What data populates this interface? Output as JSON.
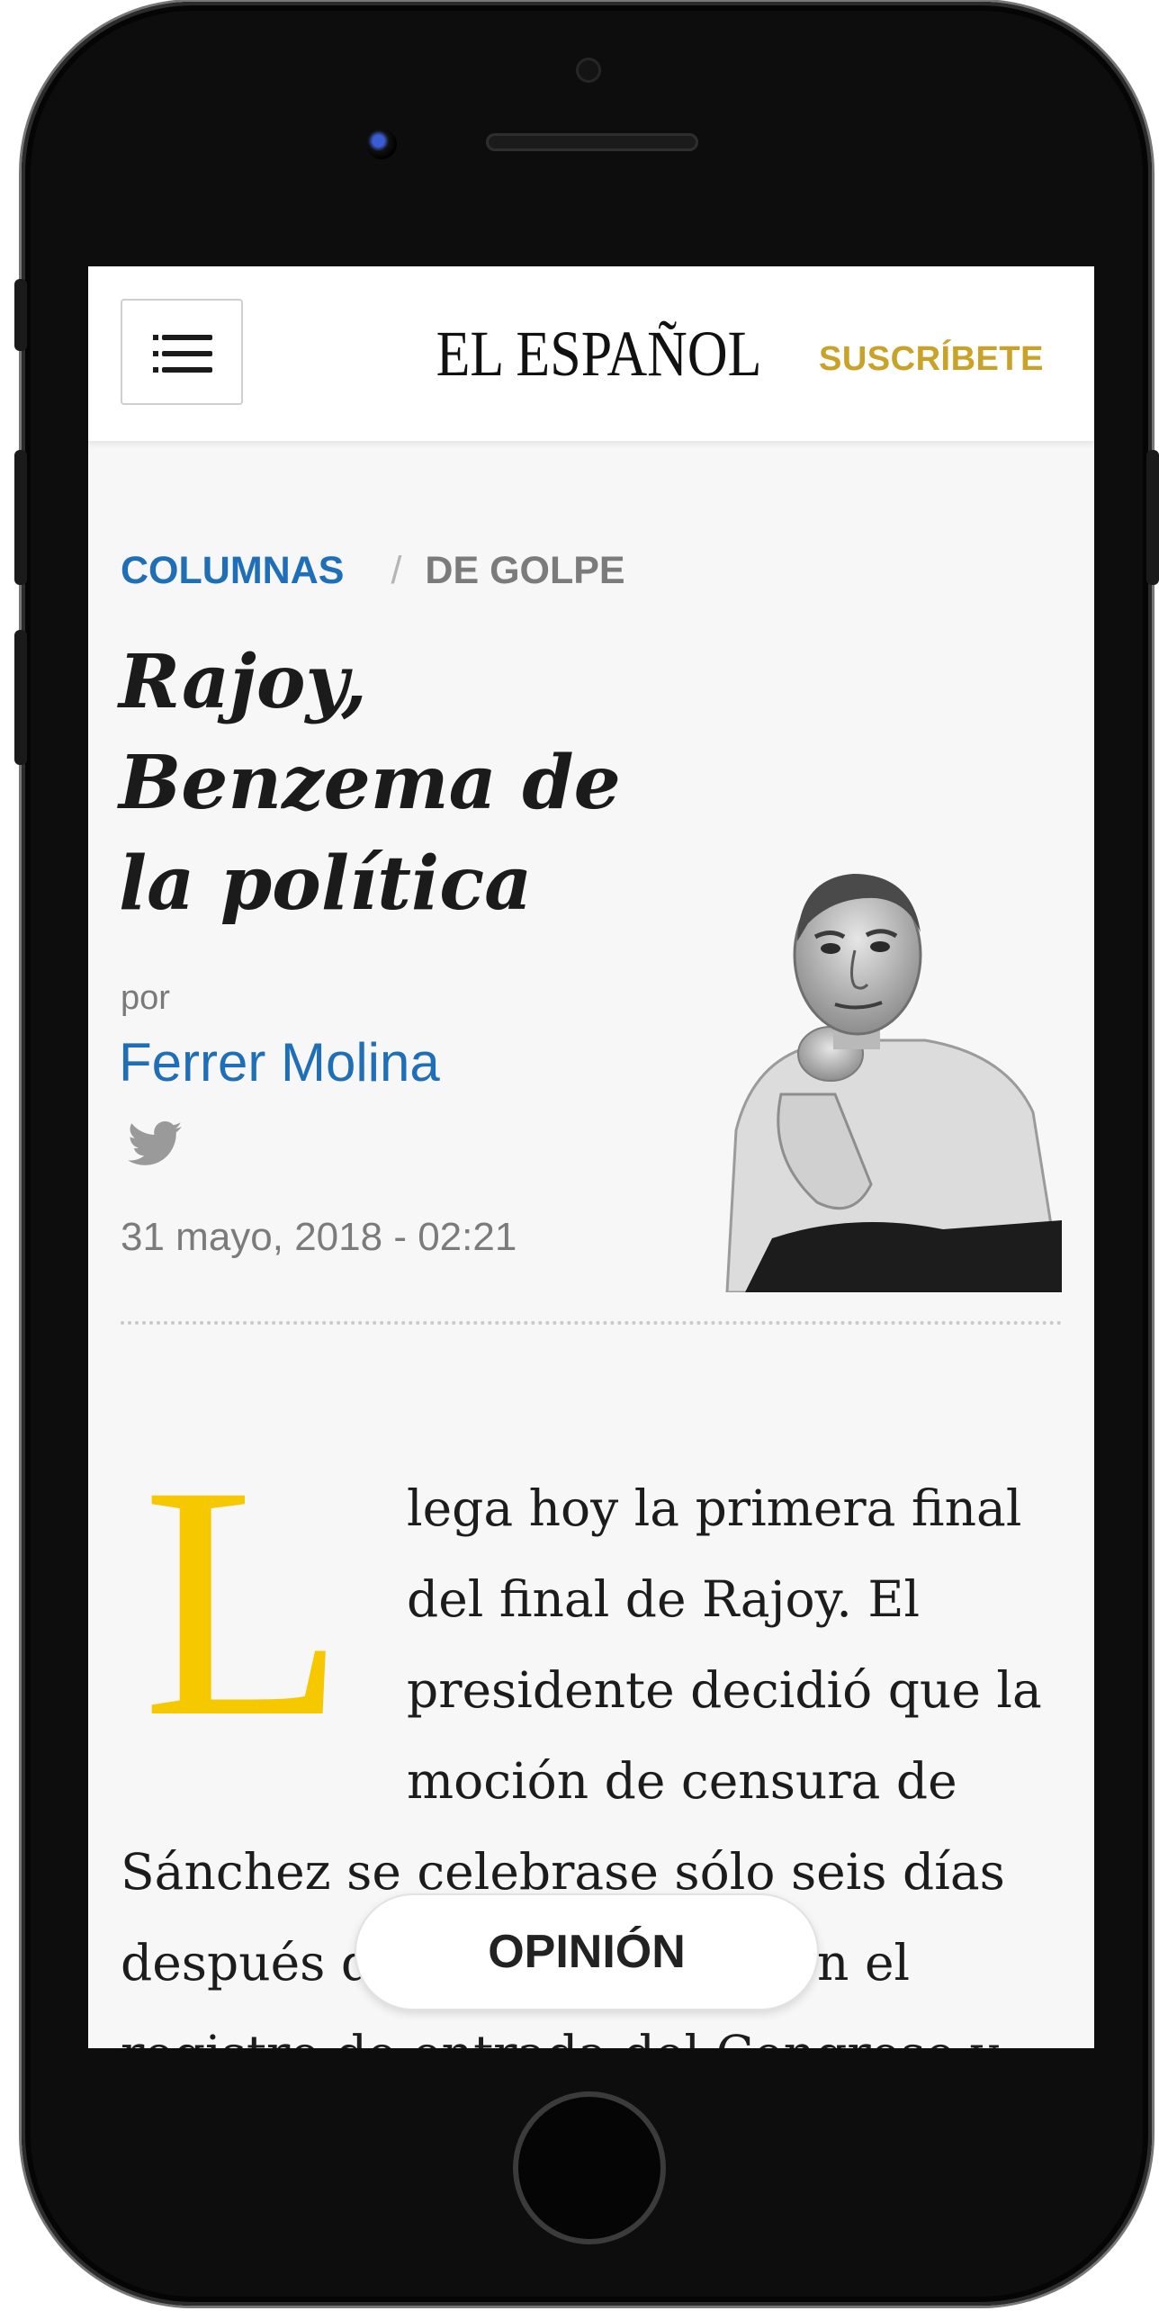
{
  "header": {
    "logo": "EL ESPAÑOL",
    "subscribe_label": "SUSCRÍBETE",
    "menu_icon": "hamburger-menu-icon"
  },
  "breadcrumb": {
    "section": "COLUMNAS",
    "separator": "/",
    "column": "DE GOLPE"
  },
  "article": {
    "title": "Rajoy, Benzema de la política",
    "by_label": "por",
    "author": "Ferrer Molina",
    "author_social_icon": "twitter-icon",
    "date": "31 mayo, 2018  -  02:21",
    "drop_cap": "L",
    "body": "lega hoy la primera final del final de Rajoy. El presidente decidió que la moción de censura de Sánchez se celebrase sólo seis días después de ser registrado en el registro de entrada del Congreso y"
  },
  "floating_section_label": "OPINIÓN",
  "colors": {
    "accent_blue": "#1f6fb8",
    "subscribe_gold": "#c9a227",
    "drop_cap_yellow": "#f5c800"
  }
}
